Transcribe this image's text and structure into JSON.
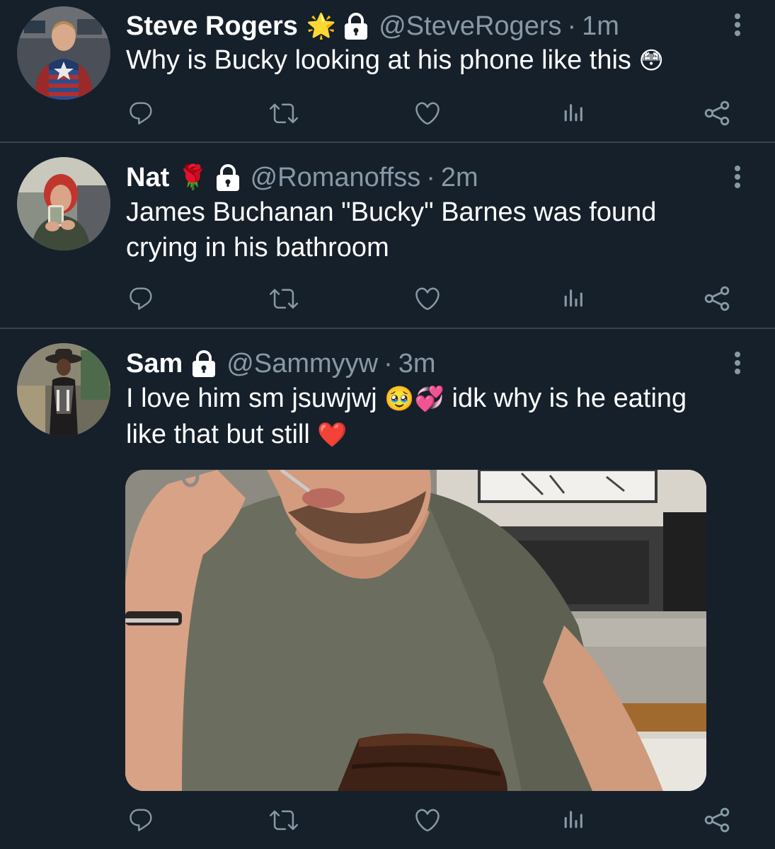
{
  "tweets": [
    {
      "name": "Steve Rogers",
      "badge_emoji": "🌟",
      "handle": "@SteveRogers",
      "separator": "·",
      "time": "1m",
      "text": "Why is Bucky looking at his phone like this",
      "text_emoji": "😳"
    },
    {
      "name": "Nat",
      "badge_emoji": "🌹",
      "handle": "@Romanoffss",
      "separator": "·",
      "time": "2m",
      "text_line1": "James Buchanan \"Bucky\" Barnes was found",
      "text_line2": "crying in his bathroom"
    },
    {
      "name": "Sam",
      "handle": "@Sammyyw",
      "separator": "·",
      "time": "3m",
      "text_part1": "I love him sm jsuwjwj ",
      "text_emoji1": "🥹💞",
      "text_part2": " idk why is he eating",
      "text_line2": "like that but still ",
      "text_emoji2": "❤️"
    }
  ],
  "icons": {
    "reply": "reply-icon",
    "retweet": "retweet-icon",
    "like": "heart-icon",
    "stats": "stats-icon",
    "share": "share-icon",
    "more": "more-icon",
    "lock": "lock-icon"
  },
  "colors": {
    "background": "#15202b",
    "divider": "#38444d",
    "secondary_text": "#8899a6",
    "primary_text": "#ffffff"
  }
}
